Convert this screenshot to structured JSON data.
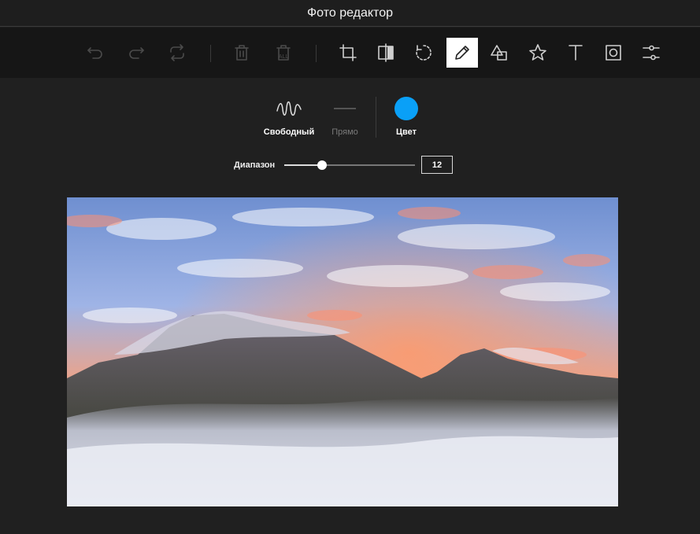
{
  "window": {
    "title": "Фото редактор"
  },
  "toolbar": {
    "tools": [
      {
        "icon": "undo-icon",
        "state": "disabled"
      },
      {
        "icon": "redo-icon",
        "state": "disabled"
      },
      {
        "icon": "reset-icon",
        "state": "disabled"
      },
      {
        "icon": "delete-icon",
        "state": "disabled"
      },
      {
        "icon": "delete-all-icon",
        "state": "disabled",
        "badge": "ALL"
      },
      {
        "icon": "crop-icon",
        "state": "enabled"
      },
      {
        "icon": "flip-icon",
        "state": "enabled"
      },
      {
        "icon": "rotate-icon",
        "state": "enabled"
      },
      {
        "icon": "draw-icon",
        "state": "active"
      },
      {
        "icon": "shape-icon",
        "state": "enabled"
      },
      {
        "icon": "star-icon",
        "state": "enabled"
      },
      {
        "icon": "text-icon",
        "state": "enabled"
      },
      {
        "icon": "mask-icon",
        "state": "enabled"
      },
      {
        "icon": "filter-icon",
        "state": "enabled"
      }
    ]
  },
  "draw_panel": {
    "modes": [
      {
        "label": "Свободный",
        "icon": "freehand-icon",
        "selected": true
      },
      {
        "label": "Прямо",
        "icon": "straight-line-icon",
        "selected": false
      }
    ],
    "color": {
      "label": "Цвет",
      "value": "#0aa0f7"
    },
    "range": {
      "label": "Диапазон",
      "value": "12",
      "fraction": 0.29
    }
  },
  "colors": {
    "accent": "#0aa0f7",
    "background": "#202020",
    "toolbar": "#161616"
  }
}
